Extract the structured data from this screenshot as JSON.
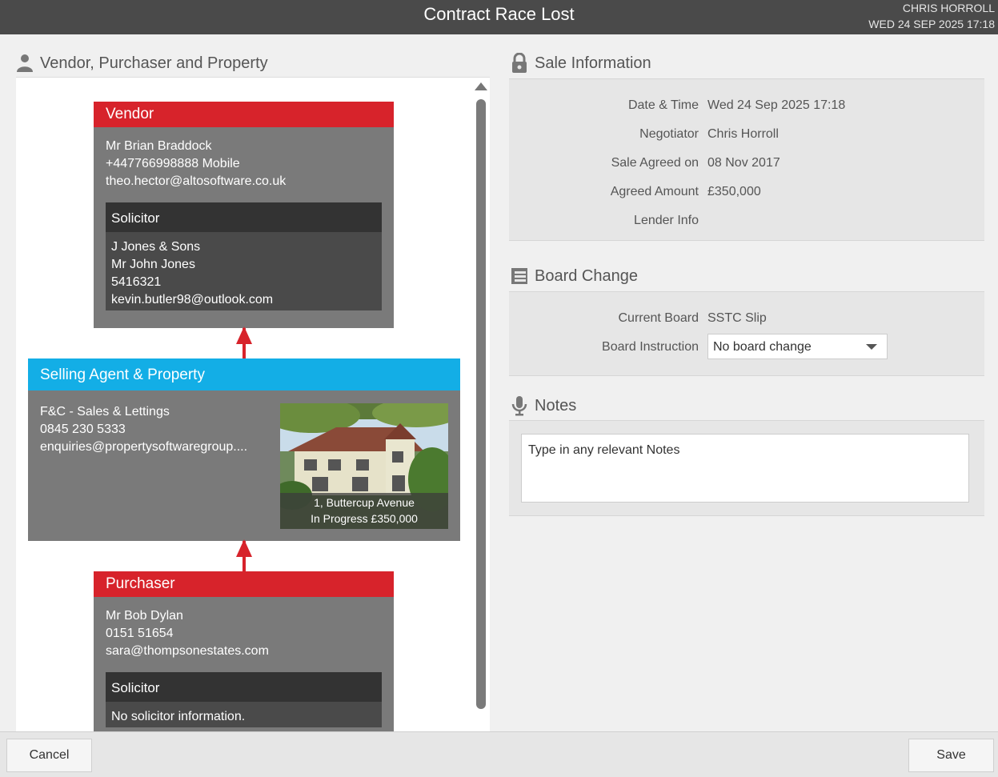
{
  "window": {
    "title": "Contract Race Lost",
    "user_name": "CHRIS HORROLL",
    "user_datetime": "WED 24 SEP 2025 17:18"
  },
  "left": {
    "heading": "Vendor, Purchaser and Property",
    "vendor": {
      "title": "Vendor",
      "name": "Mr Brian Braddock",
      "phone": "+447766998888 Mobile",
      "email": "theo.hector@altosoftware.co.uk",
      "solicitor": {
        "title": "Solicitor",
        "firm": "J Jones & Sons",
        "name": "Mr John Jones",
        "phone": "5416321",
        "email": "kevin.butler98@outlook.com"
      }
    },
    "agent": {
      "title": "Selling Agent & Property",
      "name": "F&C - Sales & Lettings",
      "phone": "0845 230 5333",
      "email": "enquiries@propertysoftwaregroup....",
      "property_address": "1, Buttercup Avenue",
      "property_status": "In Progress £350,000"
    },
    "purchaser": {
      "title": "Purchaser",
      "name": "Mr Bob Dylan",
      "phone": "0151 51654",
      "email": "sara@thompsonestates.com",
      "solicitor": {
        "title": "Solicitor",
        "info": "No solicitor information."
      }
    }
  },
  "sale_info": {
    "heading": "Sale Information",
    "rows": [
      {
        "label": "Date & Time",
        "value": "Wed 24 Sep 2025 17:18"
      },
      {
        "label": "Negotiator",
        "value": "Chris Horroll"
      },
      {
        "label": "Sale Agreed on",
        "value": "08 Nov 2017"
      },
      {
        "label": "Agreed Amount",
        "value": "£350,000"
      },
      {
        "label": "Lender Info",
        "value": ""
      }
    ]
  },
  "board_change": {
    "heading": "Board Change",
    "current_label": "Current Board",
    "current_value": "SSTC Slip",
    "instruction_label": "Board Instruction",
    "instruction_value": "No board change"
  },
  "notes": {
    "heading": "Notes",
    "placeholder": "Type in any relevant Notes"
  },
  "footer": {
    "cancel": "Cancel",
    "save": "Save"
  },
  "colors": {
    "red": "#d7232b",
    "blue": "#13aee6",
    "card": "#7a7a7a"
  }
}
